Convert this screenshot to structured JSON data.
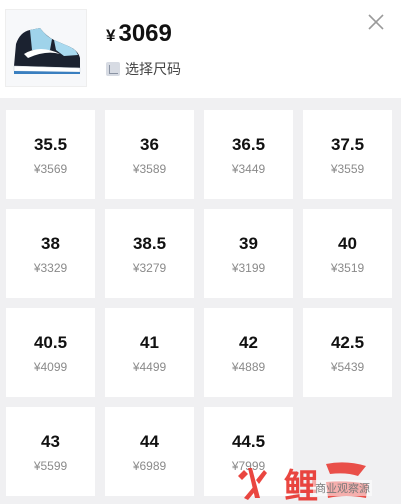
{
  "header": {
    "currency": "¥",
    "price": "3069",
    "select_size_label": "选择尺码",
    "product_image": "sneaker-thumbnail",
    "close_icon": "close-icon"
  },
  "sizes": [
    {
      "size": "35.5",
      "price": "¥3569"
    },
    {
      "size": "36",
      "price": "¥3589"
    },
    {
      "size": "36.5",
      "price": "¥3449"
    },
    {
      "size": "37.5",
      "price": "¥3559"
    },
    {
      "size": "38",
      "price": "¥3329"
    },
    {
      "size": "38.5",
      "price": "¥3279"
    },
    {
      "size": "39",
      "price": "¥3199"
    },
    {
      "size": "40",
      "price": "¥3519"
    },
    {
      "size": "40.5",
      "price": "¥4099"
    },
    {
      "size": "41",
      "price": "¥4499"
    },
    {
      "size": "42",
      "price": "¥4889"
    },
    {
      "size": "42.5",
      "price": "¥5439"
    },
    {
      "size": "43",
      "price": "¥5599"
    },
    {
      "size": "44",
      "price": "¥6989"
    },
    {
      "size": "44.5",
      "price": "¥7999"
    }
  ],
  "watermark": {
    "logo_text": "鲤",
    "caption": "商业观察源"
  },
  "colors": {
    "grid_bg": "#f0f0f2",
    "cell_bg": "#ffffff",
    "watermark_red": "#e8322c"
  }
}
